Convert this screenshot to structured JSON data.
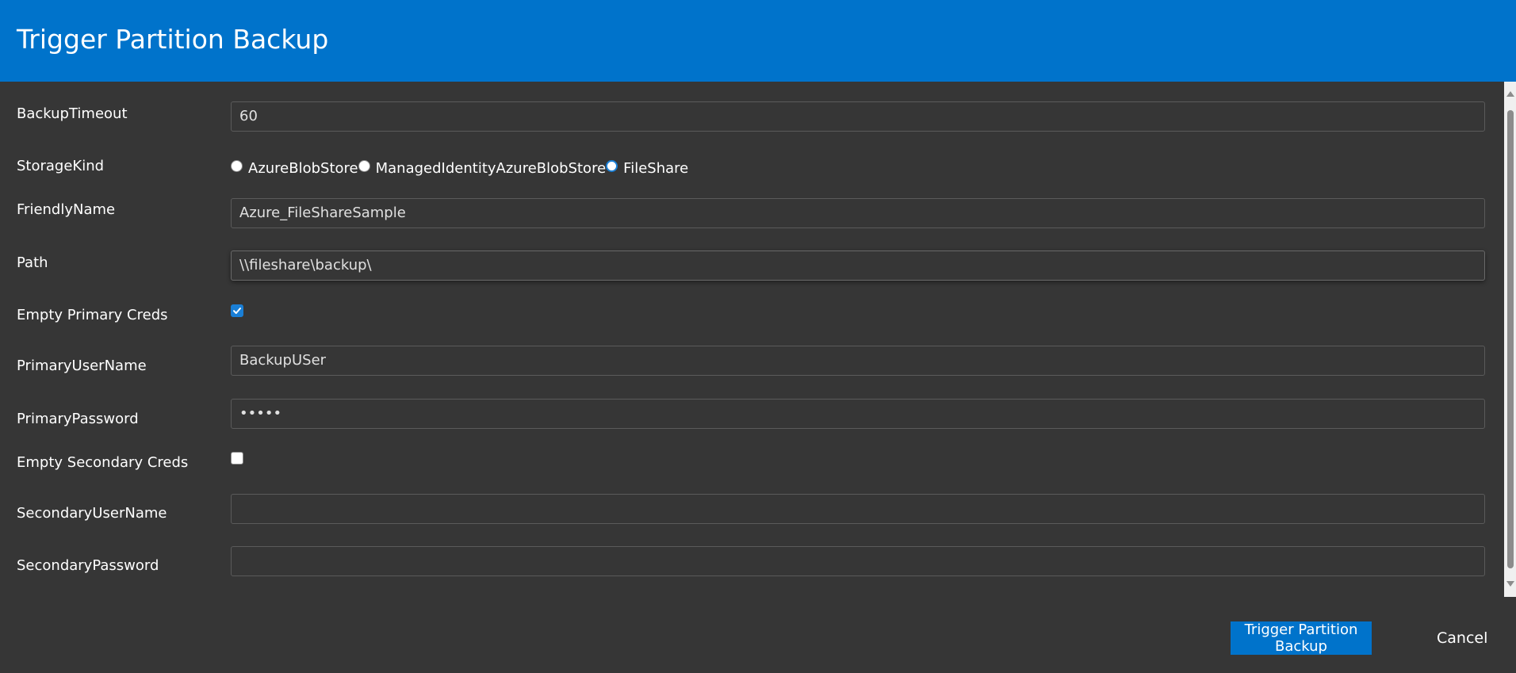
{
  "dialog": {
    "title": "Trigger Partition Backup"
  },
  "form": {
    "backup_timeout": {
      "label": "BackupTimeout",
      "value": "60"
    },
    "storage_kind": {
      "label": "StorageKind",
      "options": [
        "AzureBlobStore",
        "ManagedIdentityAzureBlobStore",
        "FileShare"
      ],
      "selected": "FileShare"
    },
    "friendly_name": {
      "label": "FriendlyName",
      "value": "Azure_FileShareSample"
    },
    "path": {
      "label": "Path",
      "value": "\\\\fileshare\\backup\\"
    },
    "empty_primary_creds": {
      "label": "Empty Primary Creds",
      "checked": true
    },
    "primary_user_name": {
      "label": "PrimaryUserName",
      "value": "BackupUSer"
    },
    "primary_password": {
      "label": "PrimaryPassword",
      "value": "•••••"
    },
    "empty_secondary_creds": {
      "label": "Empty Secondary Creds",
      "checked": false
    },
    "secondary_user_name": {
      "label": "SecondaryUserName",
      "value": ""
    },
    "secondary_password": {
      "label": "SecondaryPassword",
      "value": ""
    }
  },
  "footer": {
    "submit_label": "Trigger Partition Backup",
    "cancel_label": "Cancel"
  },
  "colors": {
    "header_bg": "#0073cb",
    "dialog_bg": "#363636",
    "accent": "#1a7fd6"
  }
}
